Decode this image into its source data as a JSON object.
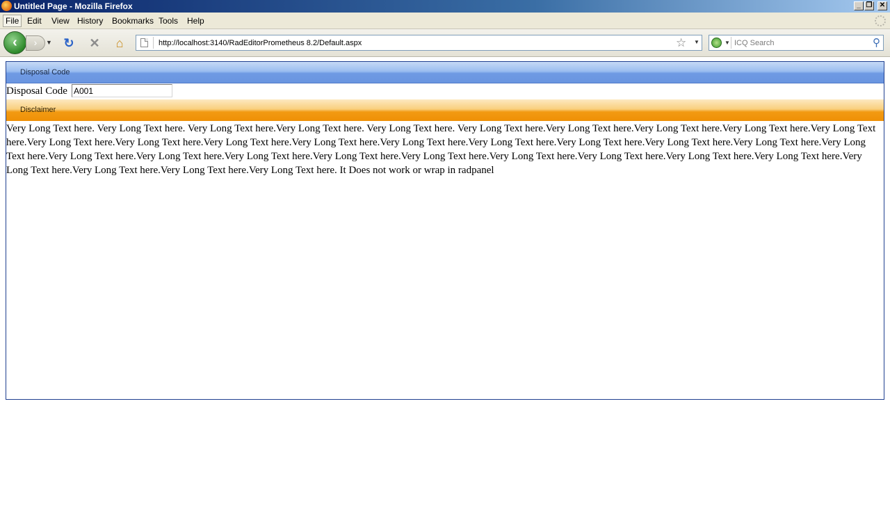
{
  "window": {
    "title": "Untitled Page - Mozilla Firefox",
    "minimize": "_",
    "maximize": "❐",
    "close": "✕"
  },
  "menu": {
    "items": [
      "File",
      "Edit",
      "View",
      "History",
      "Bookmarks",
      "Tools",
      "Help"
    ]
  },
  "toolbar": {
    "back": "‹",
    "forward": "›",
    "url": "http://localhost:3140/RadEditorPrometheus 8.2/Default.aspx",
    "search_placeholder": "ICQ Search"
  },
  "panels": {
    "disposal": {
      "header": "Disposal Code",
      "label": "Disposal Code",
      "value": "A001"
    },
    "disclaimer": {
      "header": "Disclaimer",
      "text": "Very Long Text here. Very Long Text here. Very Long Text here.Very Long Text here. Very Long Text here. Very Long Text here.Very Long Text here.Very Long Text here.Very Long Text here.Very Long Text here.Very Long Text here.Very Long Text here.Very Long Text here.Very Long Text here.Very Long Text here.Very Long Text here.Very Long Text here.Very Long Text here.Very Long Text here.Very Long Text here.Very Long Text here.Very Long Text here.Very Long Text here.Very Long Text here.Very Long Text here.Very Long Text here.Very Long Text here.Very Long Text here.Very Long Text here.Very Long Text here.Very Long Text here.Very Long Text here.Very Long Text here. It Does not work or wrap in radpanel"
    }
  },
  "colors": {
    "blue_header": "#6f9ae4",
    "orange_header": "#f29a12",
    "panel_border": "#1f3f8f"
  }
}
